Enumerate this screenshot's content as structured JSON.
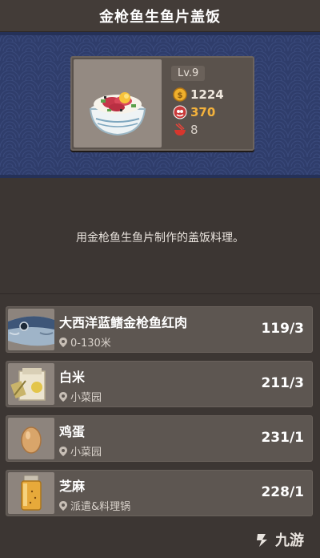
{
  "title": "金枪鱼生鱼片盖饭",
  "dish": {
    "level": "Lv.9",
    "price": "1224",
    "fame": "370",
    "taste": "8",
    "description": "用金枪鱼生鱼片制作的盖饭料理。"
  },
  "ingredients": [
    {
      "name": "大西洋蓝鳍金枪鱼红肉",
      "location": "0-130米",
      "quantity": "119/3",
      "icon": "tuna-icon"
    },
    {
      "name": "白米",
      "location": "小菜园",
      "quantity": "211/3",
      "icon": "rice-bag-icon"
    },
    {
      "name": "鸡蛋",
      "location": "小菜园",
      "quantity": "231/1",
      "icon": "egg-icon"
    },
    {
      "name": "芝麻",
      "location": "派遣&料理锅",
      "quantity": "228/1",
      "icon": "sesame-jar-icon"
    }
  ],
  "watermark": "九游",
  "colors": {
    "banner": "#2f3d6b",
    "fame": "#f4b23c",
    "panel": "#5d5651"
  }
}
